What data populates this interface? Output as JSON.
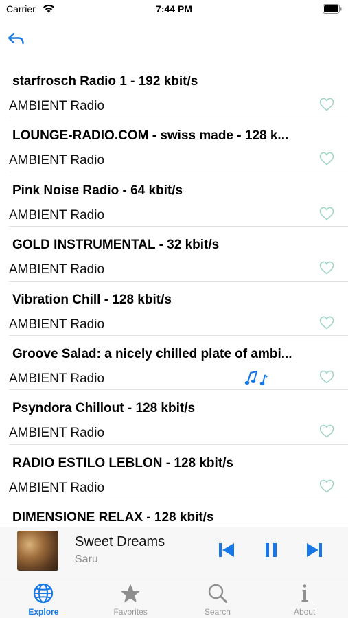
{
  "status_bar": {
    "carrier": "Carrier",
    "time": "7:44 PM"
  },
  "colors": {
    "accent": "#1877e6",
    "favorite_outline": "#9fd3c7",
    "inactive_tab": "#9a9a9a"
  },
  "stations": [
    {
      "name": "starfrosch Radio 1 - 192 kbit/s",
      "genre": "AMBIENT Radio",
      "playing": false
    },
    {
      "name": "LOUNGE-RADIO.COM - swiss made - 128 k...",
      "genre": "AMBIENT Radio",
      "playing": false
    },
    {
      "name": "Pink Noise Radio - 64 kbit/s",
      "genre": "AMBIENT Radio",
      "playing": false
    },
    {
      "name": "GOLD INSTRUMENTAL - 32 kbit/s",
      "genre": "AMBIENT Radio",
      "playing": false
    },
    {
      "name": "Vibration Chill - 128 kbit/s",
      "genre": "AMBIENT Radio",
      "playing": false
    },
    {
      "name": "Groove Salad: a nicely chilled plate of ambi...",
      "genre": "AMBIENT Radio",
      "playing": true
    },
    {
      "name": "Psyndora Chillout - 128 kbit/s",
      "genre": "AMBIENT Radio",
      "playing": false
    },
    {
      "name": "RADIO ESTILO LEBLON - 128 kbit/s",
      "genre": "AMBIENT Radio",
      "playing": false
    },
    {
      "name": "DIMENSIONE RELAX - 128 kbit/s",
      "genre": "AMBIENT Radio",
      "playing": false
    }
  ],
  "player": {
    "title": "Sweet Dreams",
    "artist": "Saru",
    "state": "playing"
  },
  "tabs": [
    {
      "label": "Explore",
      "icon": "globe-icon",
      "active": true
    },
    {
      "label": "Favorites",
      "icon": "star-icon",
      "active": false
    },
    {
      "label": "Search",
      "icon": "search-icon",
      "active": false
    },
    {
      "label": "About",
      "icon": "info-icon",
      "active": false
    }
  ]
}
